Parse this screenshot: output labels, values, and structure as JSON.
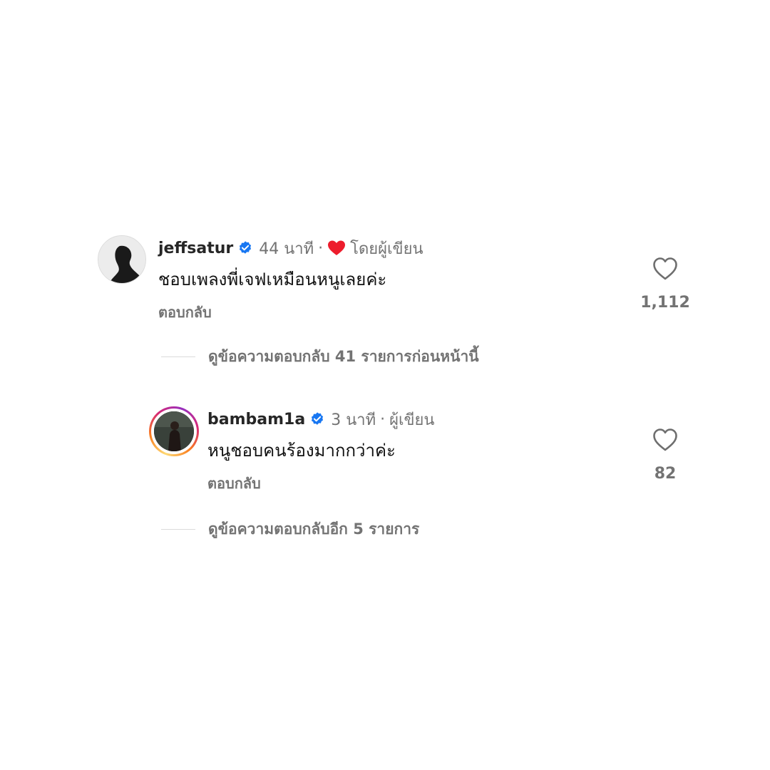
{
  "comments": [
    {
      "username": "jeffsatur",
      "time": "44 นาที",
      "separator": "·",
      "author_tag": "โดยผู้เขียน",
      "author_liked": true,
      "text": "ชอบเพลงพี่เจฟเหมือนหนูเลยค่ะ",
      "reply_label": "ตอบกลับ",
      "like_count": "1,112",
      "avatar_icon": "profile-silhouette"
    },
    {
      "username": "bambam1a",
      "time": "3 นาที",
      "separator": "·",
      "author_tag": "ผู้เขียน",
      "author_liked": false,
      "text": "หนูชอบคนร้องมากกว่าค่ะ",
      "reply_label": "ตอบกลับ",
      "like_count": "82",
      "avatar_icon": "profile-photo-story-ring"
    }
  ],
  "view_replies": [
    {
      "label": "ดูข้อความตอบกลับ 41 รายการก่อนหน้านี้"
    },
    {
      "label": "ดูข้อความตอบกลับอีก 5 รายการ"
    }
  ],
  "colors": {
    "verified_blue": "#1877f2",
    "heart_red": "#ed1c2c",
    "muted_text": "#737373",
    "story_ring": [
      "#feda75",
      "#fa7e1e",
      "#d62976",
      "#962fbf"
    ]
  }
}
